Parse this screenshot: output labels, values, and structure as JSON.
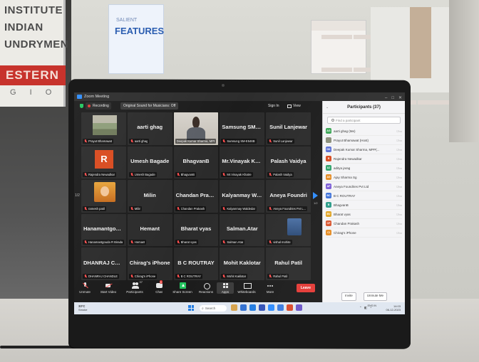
{
  "background": {
    "poster_left_lines": [
      "INSTITUTE",
      "INDIAN",
      "UNDRYMEN"
    ],
    "poster_left_red": "ESTERN",
    "poster_left_letters": "G  I  O",
    "banner_mid_small": "SALIENT",
    "banner_mid_title": "FEATURES"
  },
  "window": {
    "title": "Zoom Meeting"
  },
  "topbar": {
    "recording": "Recording",
    "original_sound": "Original Sound for Musicians: Off",
    "sign_in": "Sign In",
    "view": "View"
  },
  "tiles": [
    {
      "name": "",
      "label": "Prayut Bhamawat",
      "type": "landscape"
    },
    {
      "name": "aarti ghag",
      "label": "aarti ghag",
      "type": "name"
    },
    {
      "name": "",
      "label": "Deepak Kumar Sharma, MPP(...",
      "type": "video",
      "active": true
    },
    {
      "name": "Samsung SM-E...",
      "label": "Samsung SM-E546B",
      "type": "name"
    },
    {
      "name": "Sunil Lanjewar",
      "label": "Sunil Lanjewar",
      "type": "name"
    },
    {
      "name": "",
      "label": "Rajendra Newadkar",
      "type": "r"
    },
    {
      "name": "Umesh Bagade",
      "label": "Umesh Bagade",
      "type": "name"
    },
    {
      "name": "BhagvanB",
      "label": "BhagvanB",
      "type": "name"
    },
    {
      "name": "Mr.Vinayak Kha...",
      "label": "Mr.Vinayak Khatre",
      "type": "name"
    },
    {
      "name": "Palash Vaidya",
      "label": "Palash Vaidya",
      "type": "name"
    },
    {
      "name": "",
      "label": "ramesh patil",
      "type": "deity"
    },
    {
      "name": "Milin",
      "label": "Milin",
      "type": "name"
    },
    {
      "name": "Chandan Prakash",
      "label": "Chandan Prakash",
      "type": "name"
    },
    {
      "name": "Kalyanmay Wa...",
      "label": "Kalyanmay Waldedar",
      "type": "name"
    },
    {
      "name": "Aneya Foundri",
      "label": "Aneya Foundries Pvt L...",
      "type": "name"
    },
    {
      "name": "Hanamantgoud...",
      "label": "Hanamantgouda R Biradar",
      "type": "name"
    },
    {
      "name": "Hemant",
      "label": "Hemant",
      "type": "name"
    },
    {
      "name": "Bharat vyas",
      "label": "Bharat vyas",
      "type": "name"
    },
    {
      "name": "Salman.Atar",
      "label": "Salman.Atar",
      "type": "name"
    },
    {
      "name": "",
      "label": "vishal mohite",
      "type": "person"
    },
    {
      "name": "DHANRAJ CHA...",
      "label": "DHANRAJ CHANDLE",
      "type": "name"
    },
    {
      "name": "Chirag's iPhone",
      "label": "Chirag's iPhone",
      "type": "name"
    },
    {
      "name": "B C ROUTRAY",
      "label": "B C ROUTRAY",
      "type": "name"
    },
    {
      "name": "Mohit Kaklotar",
      "label": "Mohit Kaklotar",
      "type": "name"
    },
    {
      "name": "Rahul Patil",
      "label": "Rahul Patil",
      "type": "name"
    }
  ],
  "page_left": "1/2",
  "page_right": "1/2",
  "toolbar": {
    "unmute": "Unmute",
    "start_video": "Start Video",
    "participants": "Participants",
    "participants_count": "37",
    "chat": "Chat",
    "chat_badge": "9",
    "share": "Share Screen",
    "reactions": "Reactions",
    "apps": "Apps",
    "whiteboards": "Whiteboards",
    "more": "More",
    "leave": "Leave"
  },
  "panel": {
    "title": "Participants (37)",
    "search_placeholder": "Find a participant",
    "invite": "Invite",
    "unmute_me": "Unmute Me",
    "people": [
      {
        "initials": "AG",
        "name": "aarti ghag (Me)",
        "color": "#3aa655"
      },
      {
        "initials": "",
        "name": "Prayut Bhamawat (Host)",
        "color": "#8a8f7a"
      },
      {
        "initials": "DK",
        "name": "Deepak Kumar Sharma, MPP(...",
        "color": "#5a6fd6"
      },
      {
        "initials": "R",
        "name": "Rajendra Newadkar",
        "color": "#d94a1e"
      },
      {
        "initials": "AJ",
        "name": "aditya jarag",
        "color": "#2fa36b"
      },
      {
        "initials": "AS",
        "name": "Ajay Sharma Sg",
        "color": "#e58b22"
      },
      {
        "initials": "AF",
        "name": "Aneya Foundries Pvt Ltd",
        "color": "#7b5cd6"
      },
      {
        "initials": "BC",
        "name": "B C ROUTRAY",
        "color": "#3b6fd8"
      },
      {
        "initials": "B",
        "name": "BhagvanB",
        "color": "#2b9c88"
      },
      {
        "initials": "BV",
        "name": "Bharat vyas",
        "color": "#e0a321"
      },
      {
        "initials": "CP",
        "name": "Chandan Prakash",
        "color": "#d9532c"
      },
      {
        "initials": "CI",
        "name": "Chirag's iPhone",
        "color": "#e58b22"
      }
    ]
  },
  "taskbar": {
    "temp": "33°C",
    "weather": "Smoke",
    "search": "Search",
    "lang": "ENG IN",
    "time": "14:03",
    "date": "06-12-2023"
  }
}
